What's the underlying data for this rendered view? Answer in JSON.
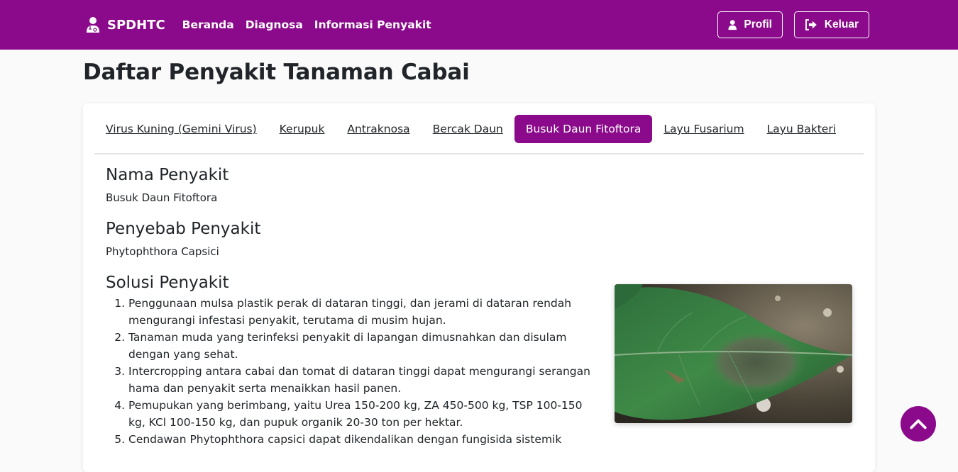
{
  "nav": {
    "brand": "SPDHTC",
    "links": [
      "Beranda",
      "Diagnosa",
      "Informasi Penyakit"
    ],
    "profile_label": "Profil",
    "logout_label": "Keluar"
  },
  "page_title": "Daftar Penyakit Tanaman Cabai",
  "tabs": [
    {
      "label": "Virus Kuning (Gemini Virus)",
      "active": false
    },
    {
      "label": "Kerupuk",
      "active": false
    },
    {
      "label": "Antraknosa",
      "active": false
    },
    {
      "label": "Bercak Daun",
      "active": false
    },
    {
      "label": "Busuk Daun Fitoftora",
      "active": true
    },
    {
      "label": "Layu Fusarium",
      "active": false
    },
    {
      "label": "Layu Bakteri",
      "active": false
    }
  ],
  "disease": {
    "name_heading": "Nama Penyakit",
    "name_value": "Busuk Daun Fitoftora",
    "cause_heading": "Penyebab Penyakit",
    "cause_value": "Phytophthora Capsici",
    "solution_heading": "Solusi Penyakit",
    "solutions": [
      "Penggunaan mulsa plastik perak di dataran tinggi, dan jerami di dataran rendah mengurangi infestasi penyakit, terutama di musim hujan.",
      "Tanaman muda yang terinfeksi penyakit di lapangan dimusnahkan dan disulam dengan yang sehat.",
      "Intercropping antara cabai dan tomat di dataran tinggi dapat mengurangi serangan hama dan penyakit serta menaikkan hasil panen.",
      "Pemupukan yang berimbang, yaitu Urea 150-200 kg, ZA 450-500 kg, TSP 100-150 kg, KCl 100-150 kg, dan pupuk organik 20-30 ton per hektar.",
      "Cendawan Phytophthora capsici dapat dikendalikan dengan fungisida sistemik"
    ]
  },
  "colors": {
    "brand_purple": "#8b0a8b"
  },
  "icons": {
    "brand": "user-doctor-icon",
    "profile": "user-icon",
    "logout": "sign-out-icon",
    "scroll_top": "chevron-up-icon"
  }
}
